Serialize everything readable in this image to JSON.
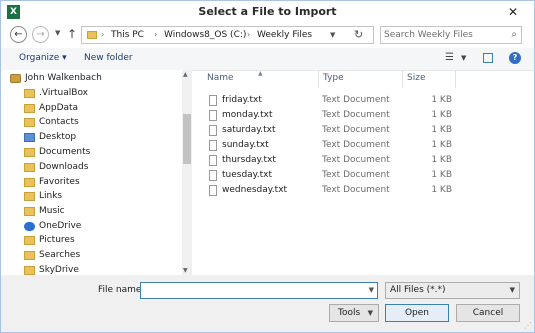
{
  "window": {
    "title": "Select a File to Import",
    "app_icon_letter": "X",
    "close_glyph": "✕"
  },
  "nav": {
    "back_glyph": "←",
    "forward_glyph": "→",
    "up_glyph": "↑",
    "breadcrumb": [
      "This PC",
      "Windows8_OS (C:)",
      "Weekly Files"
    ],
    "search_placeholder": "Search Weekly Files"
  },
  "toolbar": {
    "organize_label": "Organize ▾",
    "new_folder_label": "New folder"
  },
  "tree": {
    "items": [
      {
        "label": "John Walkenbach",
        "icon": "user-folder-icon"
      },
      {
        "label": ".VirtualBox",
        "icon": "folder-icon"
      },
      {
        "label": "AppData",
        "icon": "folder-icon"
      },
      {
        "label": "Contacts",
        "icon": "contacts-icon"
      },
      {
        "label": "Desktop",
        "icon": "desktop-icon"
      },
      {
        "label": "Documents",
        "icon": "documents-icon"
      },
      {
        "label": "Downloads",
        "icon": "downloads-icon"
      },
      {
        "label": "Favorites",
        "icon": "favorites-icon"
      },
      {
        "label": "Links",
        "icon": "links-icon"
      },
      {
        "label": "Music",
        "icon": "music-icon"
      },
      {
        "label": "OneDrive",
        "icon": "onedrive-icon"
      },
      {
        "label": "Pictures",
        "icon": "pictures-icon"
      },
      {
        "label": "Searches",
        "icon": "searches-icon"
      },
      {
        "label": "SkyDrive",
        "icon": "folder-icon"
      }
    ]
  },
  "files": {
    "columns": [
      "Name",
      "Type",
      "Size"
    ],
    "rows": [
      {
        "name": "friday.txt",
        "type": "Text Document",
        "size": "1 KB"
      },
      {
        "name": "monday.txt",
        "type": "Text Document",
        "size": "1 KB"
      },
      {
        "name": "saturday.txt",
        "type": "Text Document",
        "size": "1 KB"
      },
      {
        "name": "sunday.txt",
        "type": "Text Document",
        "size": "1 KB"
      },
      {
        "name": "thursday.txt",
        "type": "Text Document",
        "size": "1 KB"
      },
      {
        "name": "tuesday.txt",
        "type": "Text Document",
        "size": "1 KB"
      },
      {
        "name": "wednesday.txt",
        "type": "Text Document",
        "size": "1 KB"
      }
    ]
  },
  "footer": {
    "file_name_label": "File name:",
    "file_name_value": "",
    "file_type_selected": "All Files (*.*)",
    "tools_label": "Tools",
    "open_label": "Open",
    "cancel_label": "Cancel"
  },
  "colors": {
    "accent": "#3c7fb1",
    "link": "#1e3a6e",
    "excel_green": "#1d7044",
    "folder": "#e8c25a"
  }
}
